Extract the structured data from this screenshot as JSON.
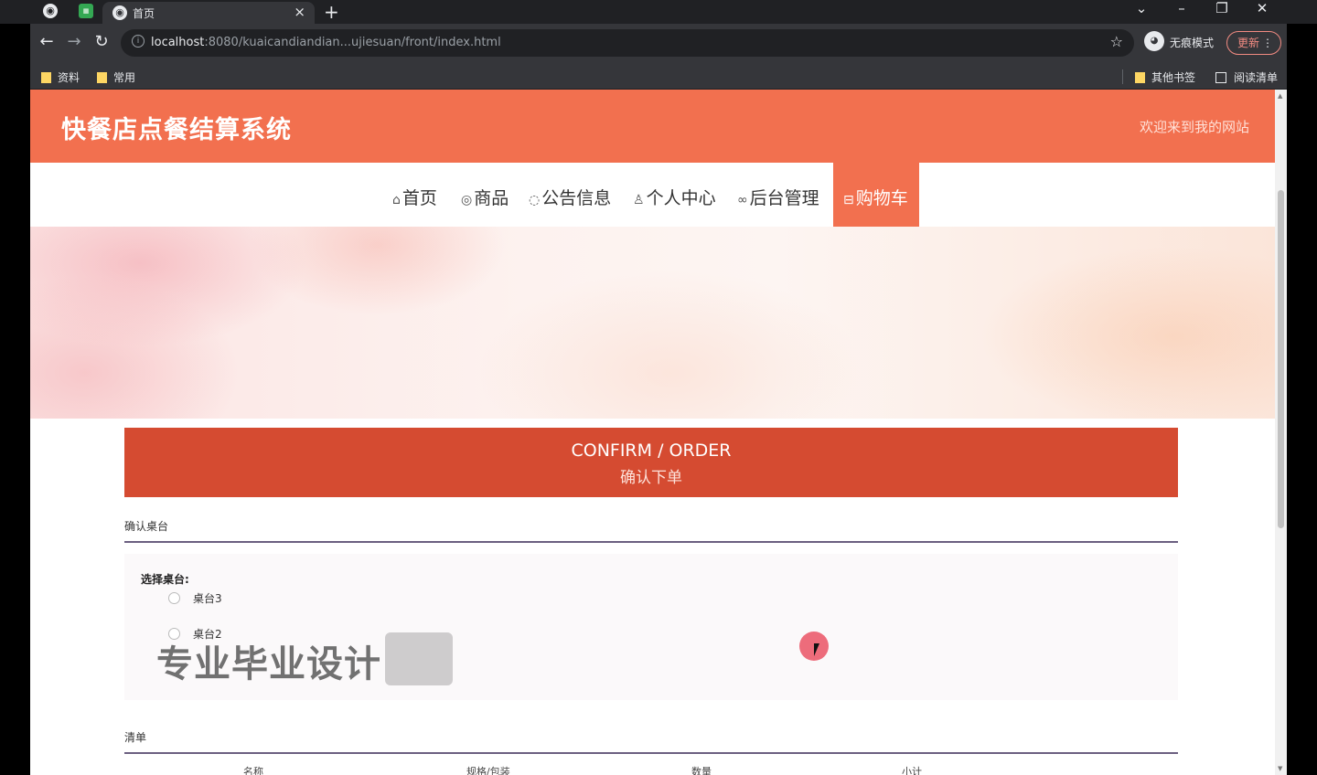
{
  "browser": {
    "tab_title": "首页",
    "url_host": "localhost",
    "url_rest": ":8080/kuaicandiandian...ujiesuan/front/index.html",
    "profile_label": "无痕模式",
    "update_label": "更新",
    "bookmarks": [
      "资料",
      "常用"
    ],
    "bookmarks_right": [
      "其他书签",
      "阅读清单"
    ]
  },
  "site": {
    "title": "快餐店点餐结算系统",
    "welcome": "欢迎来到我的网站"
  },
  "nav": {
    "items": [
      {
        "label": "首页",
        "icon": "home-icon"
      },
      {
        "label": "商品",
        "icon": "goods-icon"
      },
      {
        "label": "公告信息",
        "icon": "notice-icon"
      },
      {
        "label": "个人中心",
        "icon": "user-icon"
      },
      {
        "label": "后台管理",
        "icon": "link-icon"
      },
      {
        "label": "购物车",
        "icon": "cart-icon",
        "active": true
      }
    ]
  },
  "confirm": {
    "title_en": "CONFIRM / ORDER",
    "title_cn": "确认下单"
  },
  "table_section": {
    "label": "确认桌台",
    "select_title": "选择桌台:",
    "options": [
      "桌台3",
      "桌台2"
    ]
  },
  "watermark": "专业毕业设计",
  "list_section": {
    "label": "清单",
    "columns": [
      "名称",
      "规格/包装",
      "数量",
      "小计"
    ]
  },
  "colors": {
    "brand": "#f2704f",
    "confirm_bar": "#d54b31"
  }
}
